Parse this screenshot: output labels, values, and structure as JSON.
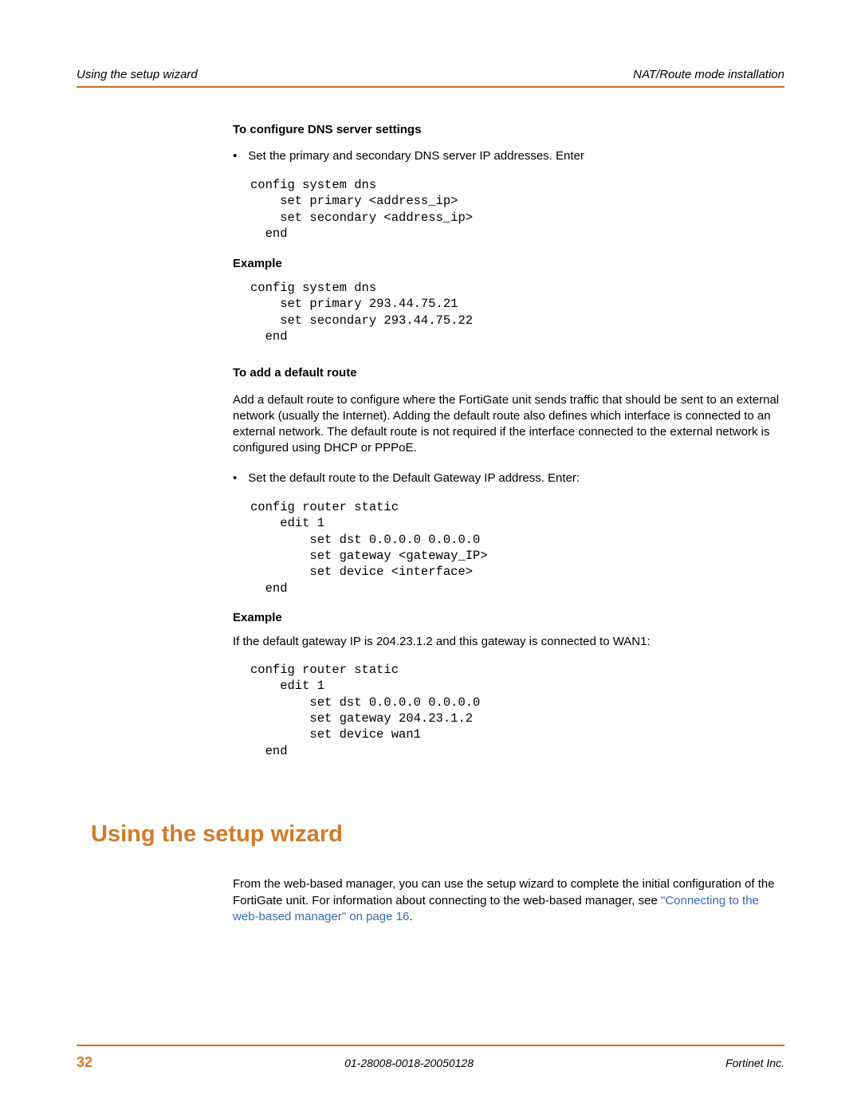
{
  "header": {
    "left": "Using the setup wizard",
    "right": "NAT/Route mode installation"
  },
  "sections": {
    "dns_heading": "To configure DNS server settings",
    "dns_bullet": "Set the primary and secondary DNS server IP addresses. Enter",
    "dns_code": "config system dns\n    set primary <address_ip>\n    set secondary <address_ip>\n  end",
    "example1_heading": "Example",
    "example1_code": "config system dns\n    set primary 293.44.75.21\n    set secondary 293.44.75.22\n  end",
    "route_heading": "To add a default route",
    "route_paragraph": "Add a default route to configure where the FortiGate unit sends traffic that should be sent to an external network (usually the Internet). Adding the default route also defines which interface is connected to an external network. The default route is not required if the interface connected to the external network is configured using DHCP or PPPoE.",
    "route_bullet": "Set the default route to the Default Gateway IP address. Enter:",
    "route_code": "config router static\n    edit 1\n        set dst 0.0.0.0 0.0.0.0\n        set gateway <gateway_IP>\n        set device <interface>\n  end",
    "example2_heading": "Example",
    "example2_paragraph": "If the default gateway IP is 204.23.1.2 and this gateway is connected to WAN1:",
    "example2_code": "config router static\n    edit 1\n        set dst 0.0.0.0 0.0.0.0\n        set gateway 204.23.1.2\n        set device wan1\n  end"
  },
  "main_heading": "Using the setup wizard",
  "main_paragraph_pre": "From the web-based manager, you can use the setup wizard to complete the initial configuration of the FortiGate unit. For information about connecting to the web-based manager, see ",
  "main_link": "\"Connecting to the web-based manager\" on page 16",
  "main_paragraph_post": ".",
  "footer": {
    "page": "32",
    "doc": "01-28008-0018-20050128",
    "company": "Fortinet Inc."
  }
}
